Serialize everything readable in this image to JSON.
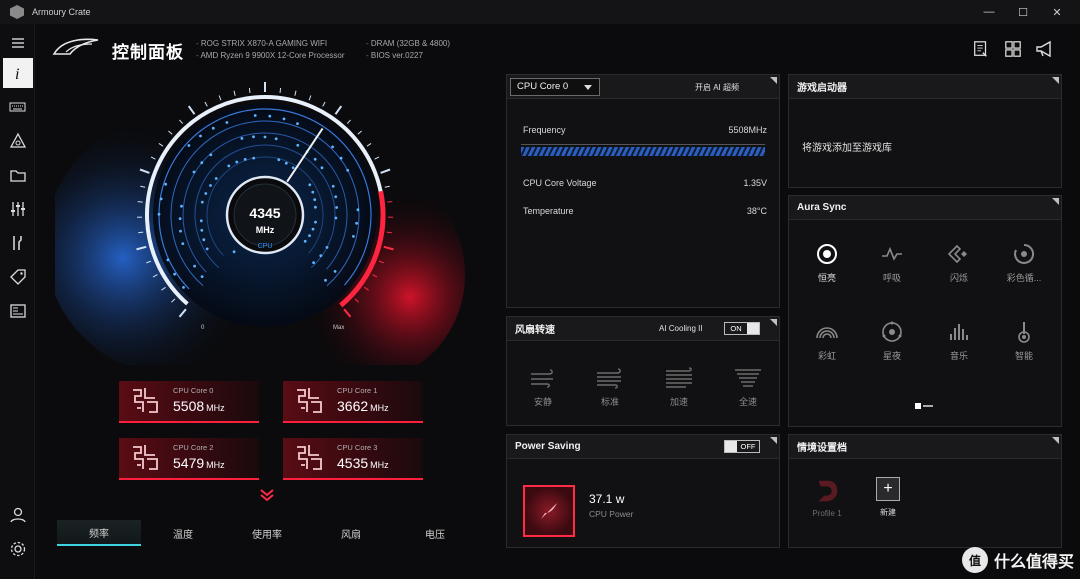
{
  "window": {
    "title": "Armoury Crate",
    "minimize": "—",
    "maximize": "☐",
    "close": "✕"
  },
  "header": {
    "title": "控制面板",
    "board": "ROG STRIX X870-A GAMING WIFI",
    "cpu": "AMD Ryzen 9 9900X 12-Core Processor",
    "dram": "DRAM (32GB & 4800)",
    "bios": "BIOS ver.0227"
  },
  "gauge": {
    "value": "4345",
    "unit": "MHz",
    "label": "CPU",
    "min_label": "0",
    "max_label": "Max",
    "level": 0.62
  },
  "cores": [
    {
      "label": "CPU Core 0",
      "value": "5508",
      "unit": "MHz"
    },
    {
      "label": "CPU Core 1",
      "value": "3662",
      "unit": "MHz"
    },
    {
      "label": "CPU Core 2",
      "value": "5479",
      "unit": "MHz"
    },
    {
      "label": "CPU Core 3",
      "value": "4535",
      "unit": "MHz"
    }
  ],
  "tabs": [
    "频率",
    "温度",
    "使用率",
    "风扇",
    "电压"
  ],
  "cpu_panel": {
    "selector": "CPU Core 0",
    "ai_label": "开启 AI 超频",
    "frequency_label": "Frequency",
    "frequency_value": "5508MHz",
    "voltage_label": "CPU Core Voltage",
    "voltage_value": "1.35V",
    "temperature_label": "Temperature",
    "temperature_value": "38°C"
  },
  "fan_panel": {
    "title": "风扇转速",
    "ai_label": "AI Cooling II",
    "toggle": "ON",
    "modes": [
      "安静",
      "标准",
      "加速",
      "全速"
    ]
  },
  "power_panel": {
    "title": "Power Saving",
    "toggle": "OFF",
    "value": "37.1 w",
    "label": "CPU Power"
  },
  "game_panel": {
    "title": "游戏启动器",
    "message": "将游戏添加至游戏库"
  },
  "aura_panel": {
    "title": "Aura Sync",
    "effects": [
      "恒亮",
      "呼吸",
      "闪烁",
      "彩色循...",
      "彩虹",
      "星夜",
      "音乐",
      "智能"
    ]
  },
  "scenario_panel": {
    "title": "情境设置档",
    "profile": "Profile 1",
    "new": "新建"
  },
  "watermark": {
    "logo": "值",
    "text": "什么值得买"
  },
  "colors": {
    "accent_cyan": "#3fd2e0",
    "accent_red": "#ff1e3c",
    "accent_blue": "#2c5fbd"
  }
}
